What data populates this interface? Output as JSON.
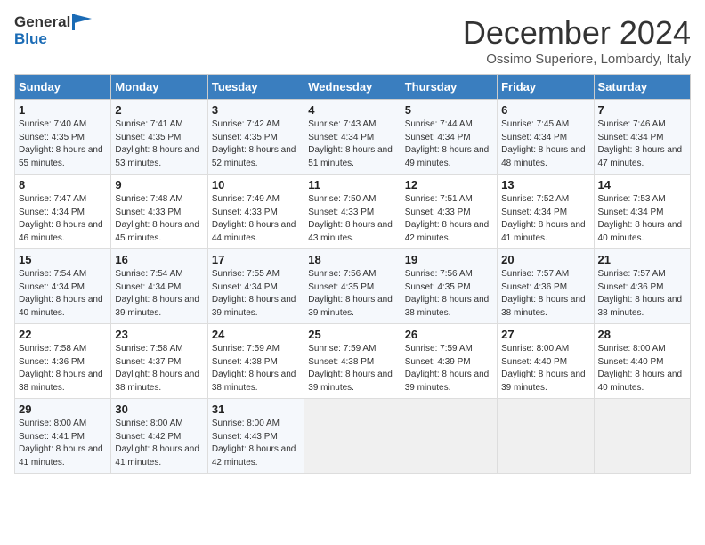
{
  "header": {
    "logo_line1": "General",
    "logo_line2": "Blue",
    "month_title": "December 2024",
    "location": "Ossimo Superiore, Lombardy, Italy"
  },
  "weekdays": [
    "Sunday",
    "Monday",
    "Tuesday",
    "Wednesday",
    "Thursday",
    "Friday",
    "Saturday"
  ],
  "weeks": [
    [
      {
        "day": "1",
        "sunrise": "Sunrise: 7:40 AM",
        "sunset": "Sunset: 4:35 PM",
        "daylight": "Daylight: 8 hours and 55 minutes."
      },
      {
        "day": "2",
        "sunrise": "Sunrise: 7:41 AM",
        "sunset": "Sunset: 4:35 PM",
        "daylight": "Daylight: 8 hours and 53 minutes."
      },
      {
        "day": "3",
        "sunrise": "Sunrise: 7:42 AM",
        "sunset": "Sunset: 4:35 PM",
        "daylight": "Daylight: 8 hours and 52 minutes."
      },
      {
        "day": "4",
        "sunrise": "Sunrise: 7:43 AM",
        "sunset": "Sunset: 4:34 PM",
        "daylight": "Daylight: 8 hours and 51 minutes."
      },
      {
        "day": "5",
        "sunrise": "Sunrise: 7:44 AM",
        "sunset": "Sunset: 4:34 PM",
        "daylight": "Daylight: 8 hours and 49 minutes."
      },
      {
        "day": "6",
        "sunrise": "Sunrise: 7:45 AM",
        "sunset": "Sunset: 4:34 PM",
        "daylight": "Daylight: 8 hours and 48 minutes."
      },
      {
        "day": "7",
        "sunrise": "Sunrise: 7:46 AM",
        "sunset": "Sunset: 4:34 PM",
        "daylight": "Daylight: 8 hours and 47 minutes."
      }
    ],
    [
      {
        "day": "8",
        "sunrise": "Sunrise: 7:47 AM",
        "sunset": "Sunset: 4:34 PM",
        "daylight": "Daylight: 8 hours and 46 minutes."
      },
      {
        "day": "9",
        "sunrise": "Sunrise: 7:48 AM",
        "sunset": "Sunset: 4:33 PM",
        "daylight": "Daylight: 8 hours and 45 minutes."
      },
      {
        "day": "10",
        "sunrise": "Sunrise: 7:49 AM",
        "sunset": "Sunset: 4:33 PM",
        "daylight": "Daylight: 8 hours and 44 minutes."
      },
      {
        "day": "11",
        "sunrise": "Sunrise: 7:50 AM",
        "sunset": "Sunset: 4:33 PM",
        "daylight": "Daylight: 8 hours and 43 minutes."
      },
      {
        "day": "12",
        "sunrise": "Sunrise: 7:51 AM",
        "sunset": "Sunset: 4:33 PM",
        "daylight": "Daylight: 8 hours and 42 minutes."
      },
      {
        "day": "13",
        "sunrise": "Sunrise: 7:52 AM",
        "sunset": "Sunset: 4:34 PM",
        "daylight": "Daylight: 8 hours and 41 minutes."
      },
      {
        "day": "14",
        "sunrise": "Sunrise: 7:53 AM",
        "sunset": "Sunset: 4:34 PM",
        "daylight": "Daylight: 8 hours and 40 minutes."
      }
    ],
    [
      {
        "day": "15",
        "sunrise": "Sunrise: 7:54 AM",
        "sunset": "Sunset: 4:34 PM",
        "daylight": "Daylight: 8 hours and 40 minutes."
      },
      {
        "day": "16",
        "sunrise": "Sunrise: 7:54 AM",
        "sunset": "Sunset: 4:34 PM",
        "daylight": "Daylight: 8 hours and 39 minutes."
      },
      {
        "day": "17",
        "sunrise": "Sunrise: 7:55 AM",
        "sunset": "Sunset: 4:34 PM",
        "daylight": "Daylight: 8 hours and 39 minutes."
      },
      {
        "day": "18",
        "sunrise": "Sunrise: 7:56 AM",
        "sunset": "Sunset: 4:35 PM",
        "daylight": "Daylight: 8 hours and 39 minutes."
      },
      {
        "day": "19",
        "sunrise": "Sunrise: 7:56 AM",
        "sunset": "Sunset: 4:35 PM",
        "daylight": "Daylight: 8 hours and 38 minutes."
      },
      {
        "day": "20",
        "sunrise": "Sunrise: 7:57 AM",
        "sunset": "Sunset: 4:36 PM",
        "daylight": "Daylight: 8 hours and 38 minutes."
      },
      {
        "day": "21",
        "sunrise": "Sunrise: 7:57 AM",
        "sunset": "Sunset: 4:36 PM",
        "daylight": "Daylight: 8 hours and 38 minutes."
      }
    ],
    [
      {
        "day": "22",
        "sunrise": "Sunrise: 7:58 AM",
        "sunset": "Sunset: 4:36 PM",
        "daylight": "Daylight: 8 hours and 38 minutes."
      },
      {
        "day": "23",
        "sunrise": "Sunrise: 7:58 AM",
        "sunset": "Sunset: 4:37 PM",
        "daylight": "Daylight: 8 hours and 38 minutes."
      },
      {
        "day": "24",
        "sunrise": "Sunrise: 7:59 AM",
        "sunset": "Sunset: 4:38 PM",
        "daylight": "Daylight: 8 hours and 38 minutes."
      },
      {
        "day": "25",
        "sunrise": "Sunrise: 7:59 AM",
        "sunset": "Sunset: 4:38 PM",
        "daylight": "Daylight: 8 hours and 39 minutes."
      },
      {
        "day": "26",
        "sunrise": "Sunrise: 7:59 AM",
        "sunset": "Sunset: 4:39 PM",
        "daylight": "Daylight: 8 hours and 39 minutes."
      },
      {
        "day": "27",
        "sunrise": "Sunrise: 8:00 AM",
        "sunset": "Sunset: 4:40 PM",
        "daylight": "Daylight: 8 hours and 39 minutes."
      },
      {
        "day": "28",
        "sunrise": "Sunrise: 8:00 AM",
        "sunset": "Sunset: 4:40 PM",
        "daylight": "Daylight: 8 hours and 40 minutes."
      }
    ],
    [
      {
        "day": "29",
        "sunrise": "Sunrise: 8:00 AM",
        "sunset": "Sunset: 4:41 PM",
        "daylight": "Daylight: 8 hours and 41 minutes."
      },
      {
        "day": "30",
        "sunrise": "Sunrise: 8:00 AM",
        "sunset": "Sunset: 4:42 PM",
        "daylight": "Daylight: 8 hours and 41 minutes."
      },
      {
        "day": "31",
        "sunrise": "Sunrise: 8:00 AM",
        "sunset": "Sunset: 4:43 PM",
        "daylight": "Daylight: 8 hours and 42 minutes."
      },
      null,
      null,
      null,
      null
    ]
  ]
}
